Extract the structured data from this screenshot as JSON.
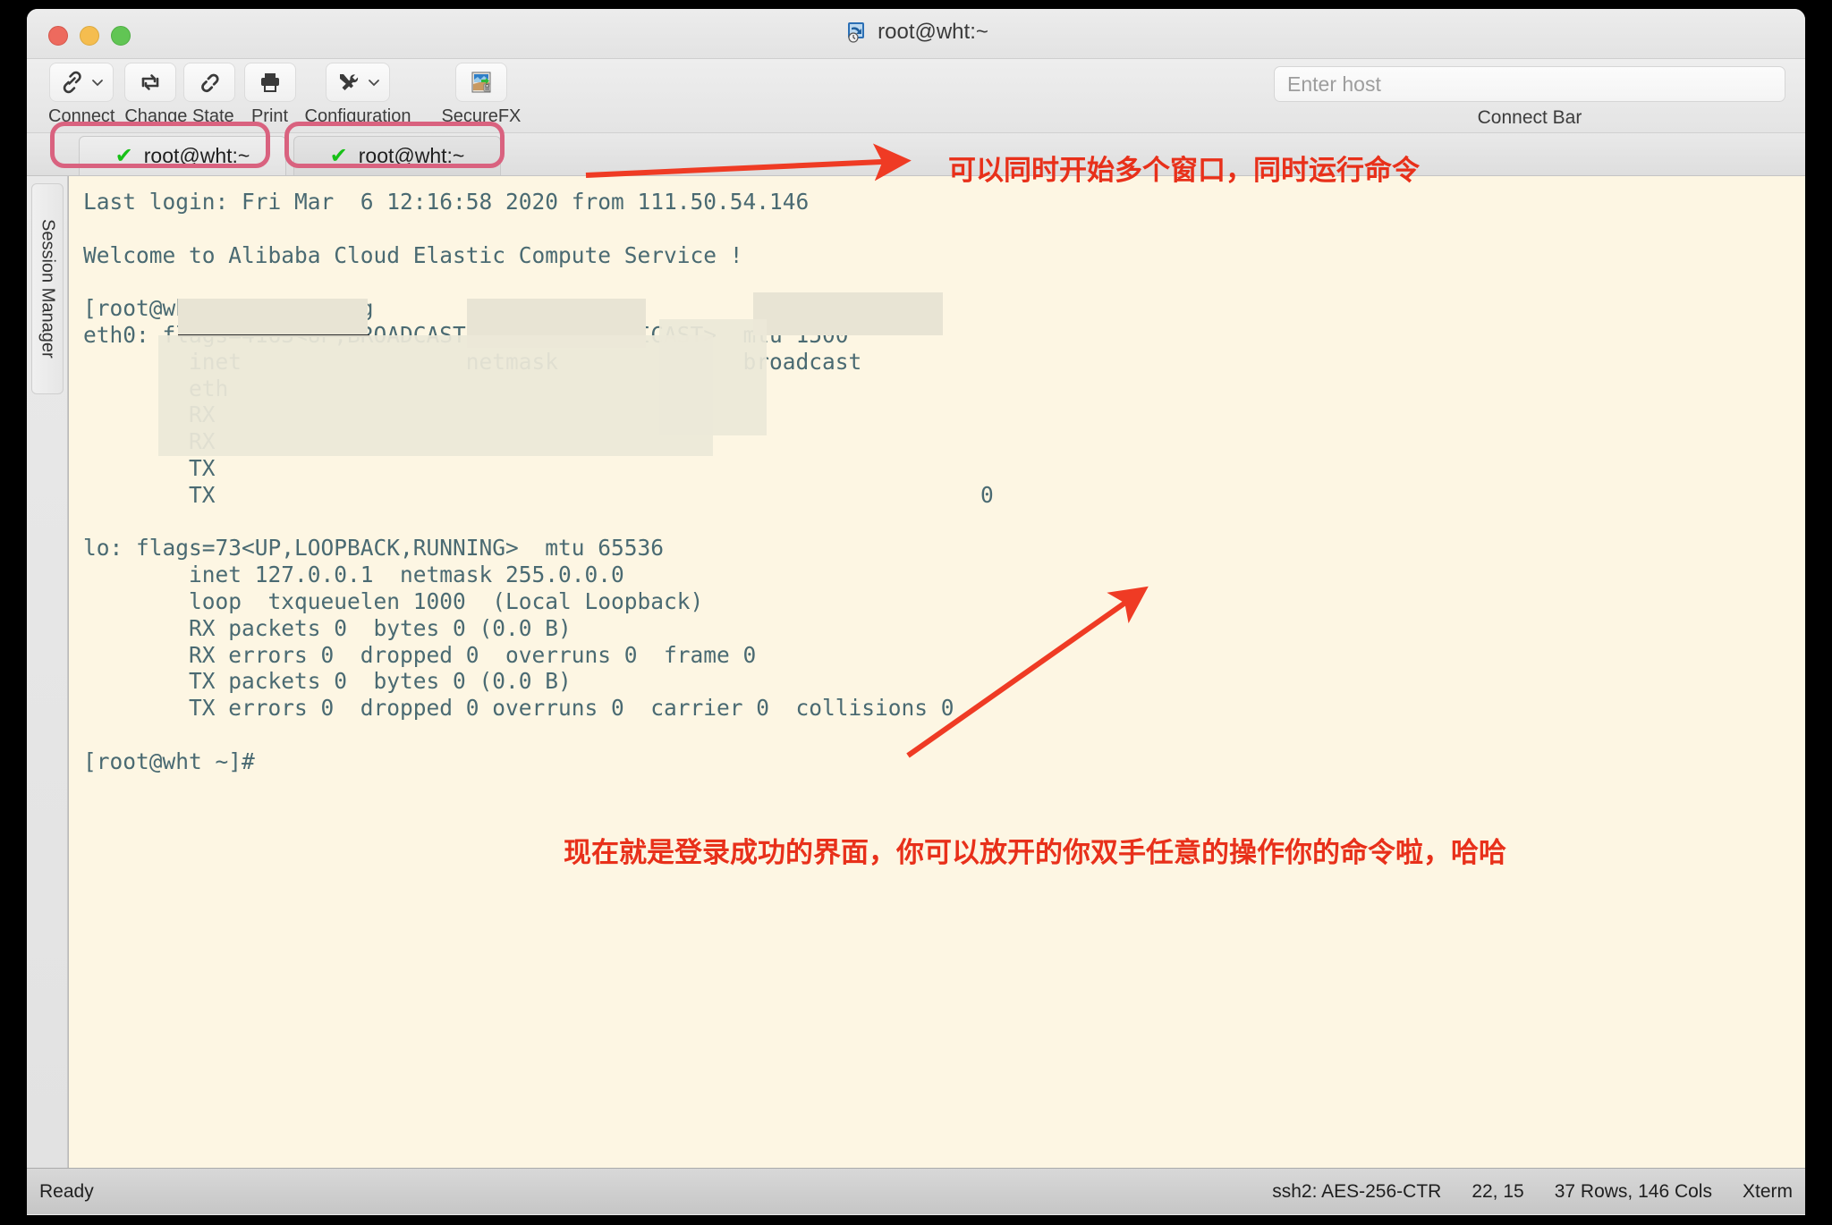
{
  "window": {
    "title": "root@wht:~",
    "title_icon": "securecrt-session-icon",
    "traffic_lights": [
      "close",
      "minimize",
      "zoom"
    ]
  },
  "toolbar": {
    "items": [
      {
        "label": "Connect",
        "icon": "link-icon",
        "has_dropdown": true
      },
      {
        "label": "Change State",
        "icon": "reconnect-icon",
        "icon2": "disconnect-icon",
        "has_dropdown": false
      },
      {
        "label": "Print",
        "icon": "printer-icon",
        "has_dropdown": false
      },
      {
        "label": "Configuration",
        "icon": "tools-icon",
        "has_dropdown": true
      },
      {
        "label": "SecureFX",
        "icon": "securefx-icon",
        "has_dropdown": false
      }
    ],
    "connect_bar": {
      "placeholder": "Enter host",
      "value": "",
      "label": "Connect Bar"
    }
  },
  "sidebar": {
    "session_manager_label": "Session Manager"
  },
  "tabs": [
    {
      "label": "root@wht:~",
      "status_icon": "green-check-icon",
      "active": false
    },
    {
      "label": "root@wht:~",
      "status_icon": "green-check-icon",
      "active": true
    }
  ],
  "terminal": {
    "lines": [
      "Last login: Fri Mar  6 12:16:58 2020 from 111.50.54.146",
      "",
      "Welcome to Alibaba Cloud Elastic Compute Service !",
      "",
      "[root@wht ~]# ifconfig",
      "eth0: flags=4163<UP,BROADCAST,RUNNING,MULTICAST>  mtu 1500",
      "        inet                 netmask              broadcast",
      "        eth",
      "        RX",
      "        RX",
      "        TX",
      "        TX                                                          0",
      "",
      "lo: flags=73<UP,LOOPBACK,RUNNING>  mtu 65536",
      "        inet 127.0.0.1  netmask 255.0.0.0",
      "        loop  txqueuelen 1000  (Local Loopback)",
      "        RX packets 0  bytes 0 (0.0 B)",
      "        RX errors 0  dropped 0  overruns 0  frame 0",
      "        TX packets 0  bytes 0 (0.0 B)",
      "        TX errors 0  dropped 0 overruns 0  carrier 0  collisions 0",
      "",
      "[root@wht ~]#"
    ],
    "background_color": "#fdf6e3",
    "text_color": "#4a6a72"
  },
  "annotations": [
    {
      "text": "可以同时开始多个窗口，同时运行命令",
      "color": "#e8301a"
    },
    {
      "text": "现在就是登录成功的界面，你可以放开的你双手任意的操作你的命令啦，哈哈",
      "color": "#e8301a"
    }
  ],
  "highlights": {
    "color": "#d9627f",
    "count": 2
  },
  "statusbar": {
    "left": "Ready",
    "protocol": "ssh2: AES-256-CTR",
    "cursor": "22, 15",
    "dimensions": "37 Rows, 146 Cols",
    "emulation": "Xterm"
  }
}
